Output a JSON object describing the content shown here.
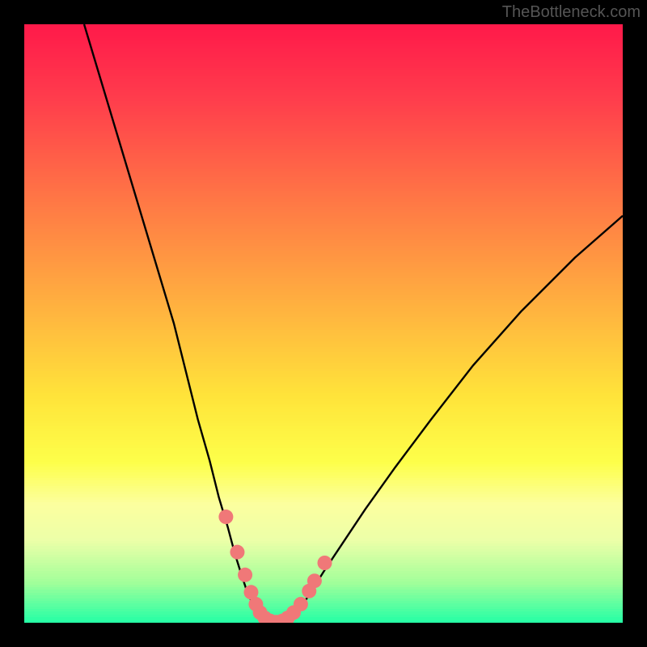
{
  "watermark": "TheBottleneck.com",
  "chart_data": {
    "type": "line",
    "title": "",
    "xlabel": "",
    "ylabel": "",
    "xlim": [
      0,
      100
    ],
    "ylim": [
      0,
      100
    ],
    "grid": false,
    "background_gradient": [
      {
        "stop": 0.0,
        "color": "#ff1a4a"
      },
      {
        "stop": 0.12,
        "color": "#ff3c4c"
      },
      {
        "stop": 0.3,
        "color": "#ff7a45"
      },
      {
        "stop": 0.48,
        "color": "#ffb53f"
      },
      {
        "stop": 0.62,
        "color": "#ffe43a"
      },
      {
        "stop": 0.73,
        "color": "#fdff4a"
      },
      {
        "stop": 0.8,
        "color": "#fcff9f"
      },
      {
        "stop": 0.86,
        "color": "#ecffa8"
      },
      {
        "stop": 0.93,
        "color": "#a3ff9a"
      },
      {
        "stop": 1.0,
        "color": "#1fffa6"
      }
    ],
    "series": [
      {
        "name": "left-curve",
        "color": "#000000",
        "x": [
          10,
          13,
          16,
          19,
          22,
          25,
          27,
          29,
          31,
          32.5,
          34,
          35.2,
          36.3,
          37.2,
          38.0,
          38.8,
          39.6
        ],
        "y": [
          100,
          90,
          80,
          70,
          60,
          50,
          42,
          34,
          27,
          21,
          16,
          11.5,
          8.0,
          5.3,
          3.5,
          2.0,
          1.0
        ]
      },
      {
        "name": "right-curve",
        "color": "#000000",
        "x": [
          45.0,
          46.2,
          47.8,
          50,
          53,
          57,
          62,
          68,
          75,
          83,
          92,
          100
        ],
        "y": [
          1.0,
          2.5,
          5.0,
          8.5,
          13,
          19,
          26,
          34,
          43,
          52,
          61,
          68
        ]
      },
      {
        "name": "floor",
        "color": "#000000",
        "x": [
          39.6,
          41,
          43,
          45.0
        ],
        "y": [
          1.0,
          0.0,
          0.0,
          1.0
        ]
      }
    ],
    "highlight_dots": {
      "color": "#f07878",
      "points": [
        {
          "x": 33.7,
          "y": 17.7
        },
        {
          "x": 35.6,
          "y": 11.8
        },
        {
          "x": 36.9,
          "y": 8.0
        },
        {
          "x": 37.9,
          "y": 5.1
        },
        {
          "x": 38.7,
          "y": 3.1
        },
        {
          "x": 39.4,
          "y": 1.7
        },
        {
          "x": 40.2,
          "y": 0.8
        },
        {
          "x": 41.1,
          "y": 0.3
        },
        {
          "x": 42.1,
          "y": 0.1
        },
        {
          "x": 43.1,
          "y": 0.3
        },
        {
          "x": 44.0,
          "y": 0.8
        },
        {
          "x": 45.0,
          "y": 1.7
        },
        {
          "x": 46.2,
          "y": 3.1
        },
        {
          "x": 47.6,
          "y": 5.3
        },
        {
          "x": 48.5,
          "y": 7.0
        },
        {
          "x": 50.2,
          "y": 10.0
        }
      ]
    }
  }
}
